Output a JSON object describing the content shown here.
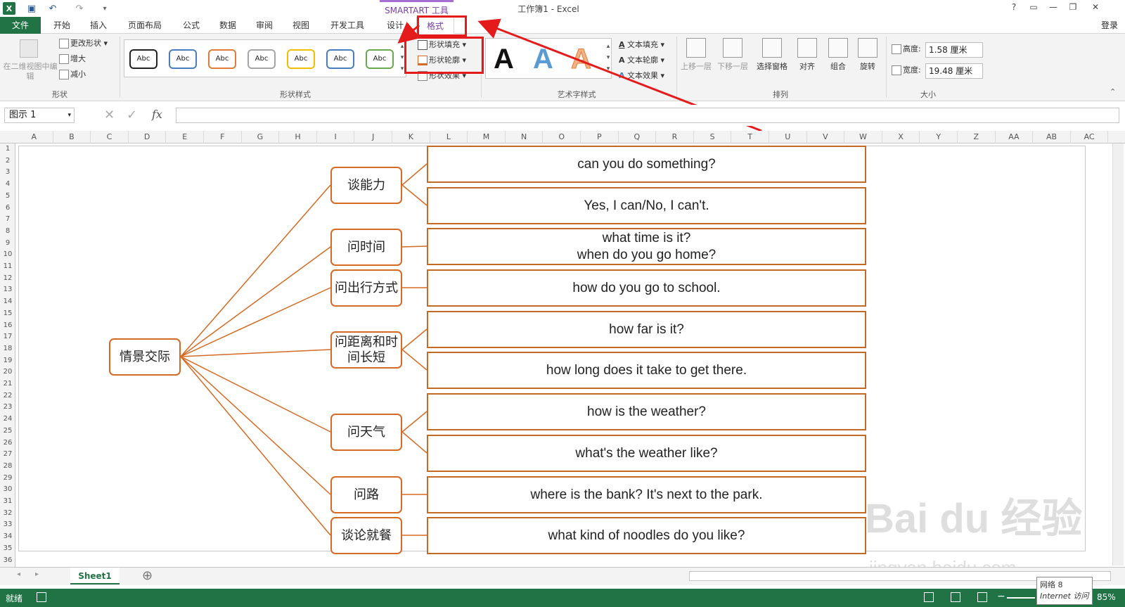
{
  "title_bar": {
    "window_title": "工作簿1 - Excel",
    "context_tab_label": "SMARTART 工具",
    "window_buttons": [
      "?",
      "▭",
      "—",
      "❐",
      "✕"
    ]
  },
  "tabs": [
    {
      "label": "文件"
    },
    {
      "label": "开始"
    },
    {
      "label": "插入"
    },
    {
      "label": "页面布局"
    },
    {
      "label": "公式"
    },
    {
      "label": "数据"
    },
    {
      "label": "审阅"
    },
    {
      "label": "视图"
    },
    {
      "label": "开发工具"
    },
    {
      "label": "设计"
    },
    {
      "label": "格式"
    }
  ],
  "login_label": "登录",
  "ribbon": {
    "shape_group": {
      "edit_in_2d": "在二维视图中编辑",
      "change_shape": "更改形状",
      "larger": "增大",
      "smaller": "减小",
      "label": "形状"
    },
    "shape_styles": {
      "label": "形状样式",
      "style_samples": [
        "Abc",
        "Abc",
        "Abc",
        "Abc",
        "Abc",
        "Abc",
        "Abc"
      ],
      "fill": "形状填充",
      "outline": "形状轮廓",
      "effects": "形状效果"
    },
    "wordart": {
      "label": "艺术字样式",
      "letters": [
        "A",
        "A",
        "A"
      ],
      "text_fill": "文本填充",
      "text_outline": "文本轮廓",
      "text_effects": "文本效果"
    },
    "arrange": {
      "label": "排列",
      "bring_forward": "上移一层",
      "send_backward": "下移一层",
      "selection_pane": "选择窗格",
      "align": "对齐",
      "group": "组合",
      "rotate": "旋转"
    },
    "size": {
      "label": "大小",
      "height_label": "高度:",
      "height_value": "1.58 厘米",
      "width_label": "宽度:",
      "width_value": "19.48 厘米"
    }
  },
  "formula_bar": {
    "name_box": "图示  1",
    "fx": "fx",
    "value": ""
  },
  "columns": [
    "A",
    "B",
    "C",
    "D",
    "E",
    "F",
    "G",
    "H",
    "I",
    "J",
    "K",
    "L",
    "M",
    "N",
    "O",
    "P",
    "Q",
    "R",
    "S",
    "T",
    "U",
    "V",
    "W",
    "X",
    "Y",
    "Z",
    "AA",
    "AB",
    "AC"
  ],
  "rows": [
    "1",
    "2",
    "3",
    "4",
    "5",
    "6",
    "7",
    "8",
    "9",
    "10",
    "11",
    "12",
    "13",
    "14",
    "15",
    "16",
    "17",
    "18",
    "19",
    "20",
    "21",
    "22",
    "23",
    "24",
    "25",
    "26",
    "27",
    "28",
    "29",
    "30",
    "31",
    "32",
    "33",
    "34",
    "35",
    "36"
  ],
  "smartart": {
    "root": "情景交际",
    "topics": [
      "谈能力",
      "问时间",
      "问出行方式",
      "问距离和时间长短",
      "问天气",
      "问路",
      "谈论就餐"
    ],
    "questions": [
      "can you do something?",
      "Yes, I can/No, I can't.",
      "what time is it?",
      "when do you go home?",
      "how do you go to school.",
      "how far is it?",
      "how long does it take to get there.",
      "how is the weather?",
      "what's the weather like?",
      "where is the bank? It's next to the park.",
      "what kind of noodles do you like?"
    ],
    "line_color": "#d46a23"
  },
  "sheet_tabs": {
    "active": "Sheet1",
    "add": "⊕"
  },
  "status": {
    "ready": "就绪",
    "zoom": "85%"
  },
  "tooltip": {
    "line1": "网络 8",
    "line2": "Internet 访问"
  },
  "watermark": {
    "brand": "Bai du 经验",
    "url": "jingyan.baidu.com"
  }
}
